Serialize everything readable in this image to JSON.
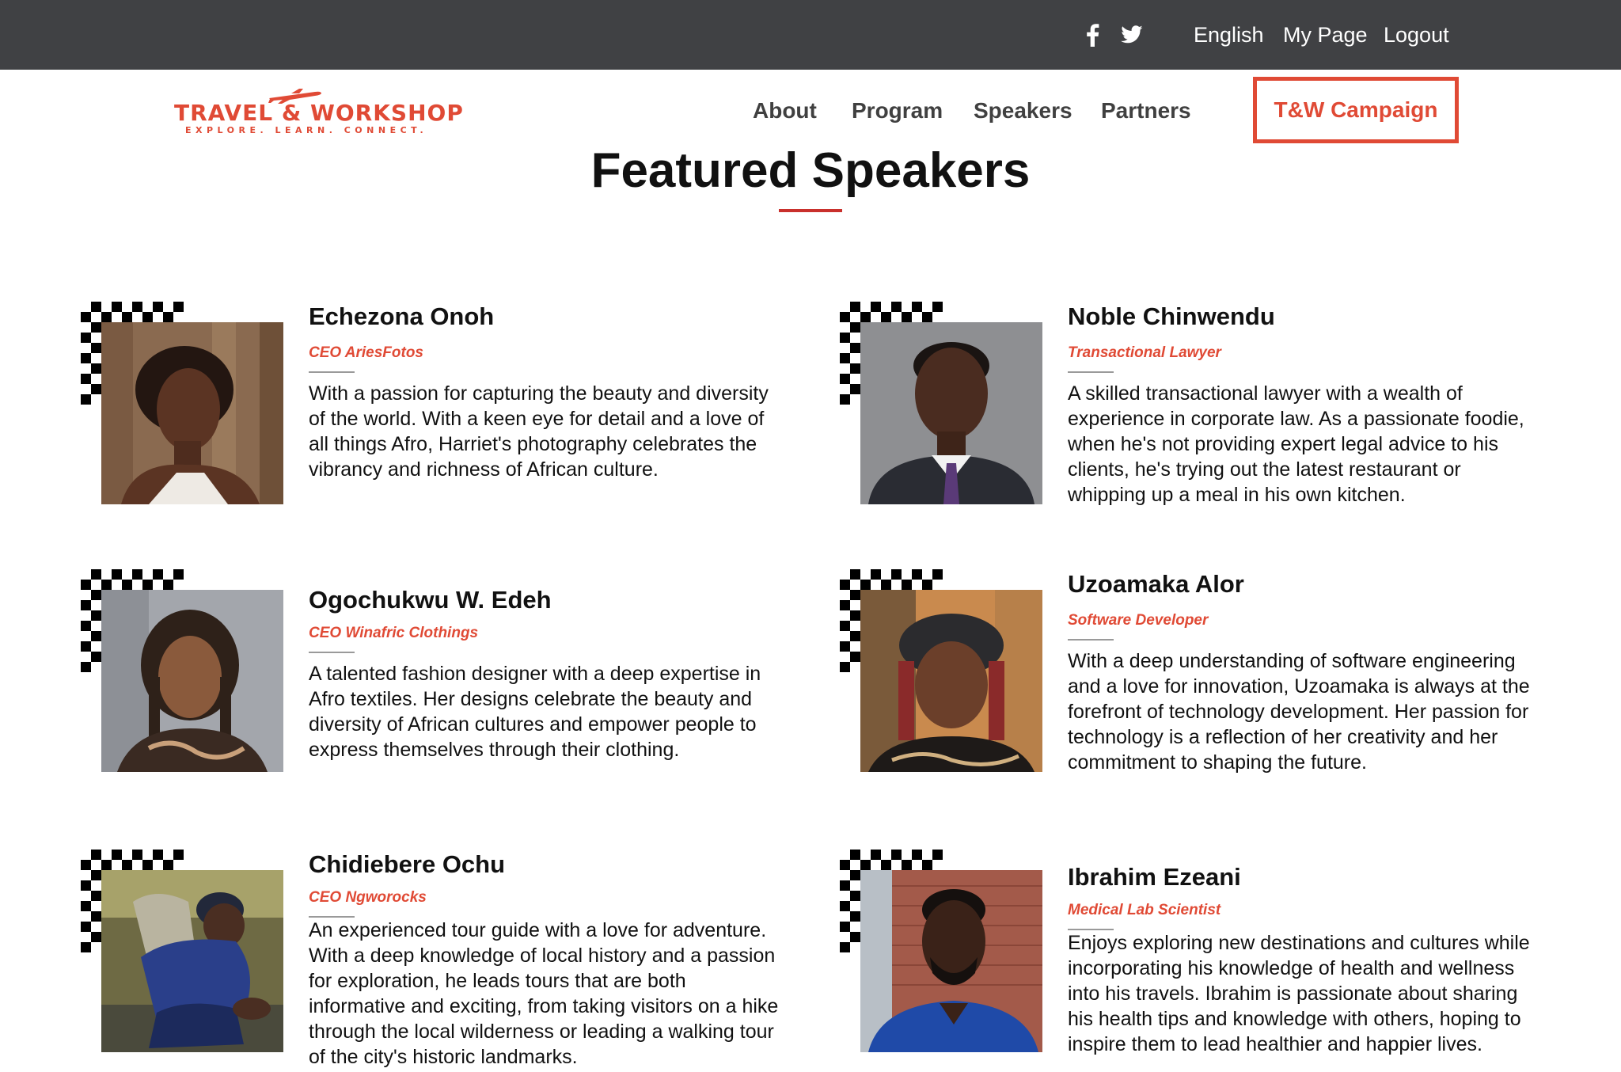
{
  "topbar": {
    "facebook_icon": "facebook-icon",
    "twitter_icon": "twitter-icon",
    "language": "English",
    "my_page": "My Page",
    "logout": "Logout",
    "background": "#404144"
  },
  "logo": {
    "title": "TRAVEL & WORKSHOP",
    "tagline": "EXPLORE. LEARN. CONNECT.",
    "icon": "airplane-icon",
    "color": "#e04a35"
  },
  "nav": {
    "items": [
      "About",
      "Program",
      "Speakers",
      "Partners"
    ],
    "campaign": "T&W Campaign"
  },
  "page_title": "Featured Speakers",
  "speakers": [
    {
      "name": "Echezona Onoh",
      "role": "CEO AriesFotos",
      "bio": "With a passion for capturing the beauty and diversity of the world. With a keen eye for detail and a love of all things Afro, Harriet's photography celebrates the vibrancy and richness of African culture."
    },
    {
      "name": "Noble Chinwendu",
      "role": "Transactional Lawyer",
      "bio": "A skilled transactional lawyer with a wealth of experience in corporate law. As a passionate foodie, when he's not providing expert legal advice to his clients, he's trying out the latest restaurant or whipping up a meal in his own kitchen."
    },
    {
      "name": "Ogochukwu W. Edeh",
      "role": "CEO Winafric Clothings",
      "bio": "A talented fashion designer with a deep expertise in Afro textiles. Her designs celebrate the beauty and diversity of African cultures and empower people to express themselves through their clothing."
    },
    {
      "name": "Uzoamaka Alor",
      "role": "Software Developer",
      "bio": "With a deep understanding of software engineering and a love for innovation, Uzoamaka is always at the forefront of technology development. Her passion for technology is a reflection of her creativity and her commitment to shaping the future."
    },
    {
      "name": "Chidiebere Ochu",
      "role": "CEO Ngworocks",
      "bio": "An experienced tour guide with a love for adventure. With a deep knowledge of local history and a passion for exploration, he leads tours that are both informative and exciting, from taking visitors on a hike through the local wilderness or leading a walking tour of the city's historic landmarks."
    },
    {
      "name": "Ibrahim Ezeani",
      "role": "Medical Lab Scientist",
      "bio": "Enjoys exploring new destinations and cultures while incorporating his knowledge of health and wellness into his travels. Ibrahim is passionate about sharing his health tips and knowledge with others, hoping to inspire them to lead healthier and happier lives."
    }
  ],
  "colors": {
    "accent": "#e04a35",
    "heading_rule": "#c9302c"
  }
}
